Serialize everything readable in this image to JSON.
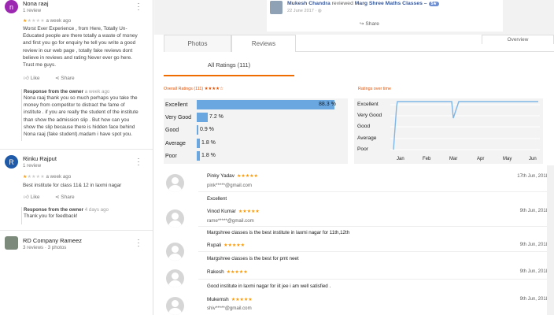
{
  "reviews": [
    {
      "initial": "n",
      "avatar_color": "#9c27b0",
      "name": "Nona raaj",
      "sub": "1 review",
      "rating": 1,
      "time": "a week ago",
      "text": "Worst Ever Experience , from Here, Totally Un-Educated people are there totally a waste of money and first you go for enquiry he tell you write a good review in our web page , totally fake reviews dont believe in reviews and rating Never ever go here. Trust me guys.",
      "like": "Like",
      "share": "Share",
      "owner_title": "Response from the owner",
      "owner_time": "a week ago",
      "owner_text": "Nona raaj thank you so much perhaps you take the money from competitor to distract the fame of institute . if you are really the student of the institute than show the admission slip . But how  can you show the slip because there is hidden face behind Nona raaj (fake student).madam i have spot you."
    },
    {
      "initial": "R",
      "avatar_color": "#1e5aa8",
      "name": "Rinku Rajput",
      "sub": "1 review",
      "rating": 1,
      "time": "a week ago",
      "text": "Best institute for class 11& 12 in laxmi nagar",
      "like": "Like",
      "share": "Share",
      "owner_title": "Response from the owner",
      "owner_time": "4 days ago",
      "owner_text": "Thank you for feedback!"
    },
    {
      "name": "RD Company Rameez",
      "sub": "3 reviews · 3 photos"
    }
  ],
  "facebook": {
    "name": "Mukesh Chandra",
    "reviewed": "reviewed",
    "page": "Marg Shree Maths Classes –",
    "badge": "5★",
    "date": "22 June 2017 · ",
    "share": "Share"
  },
  "tabs": {
    "photos": "Photos",
    "reviews": "Reviews",
    "overview": "Overview"
  },
  "all_ratings": "All Ratings (111)",
  "overall_title": "Overall Ratings (111) ★★★★☆",
  "over_time_title": "Ratings over time",
  "rating_bars": [
    {
      "label": "Excellent",
      "value": "88.3 %",
      "pct": 88.3
    },
    {
      "label": "Very Good",
      "value": "7.2 %",
      "pct": 7.2
    },
    {
      "label": "Good",
      "value": "0.9 %",
      "pct": 0.9
    },
    {
      "label": "Average",
      "value": "1.8 %",
      "pct": 1.8
    },
    {
      "label": "Poor",
      "value": "1.8 %",
      "pct": 1.8
    }
  ],
  "over_time": {
    "labels": [
      "Excellent",
      "Very Good",
      "Good",
      "Average",
      "Poor"
    ],
    "months": [
      "Jan",
      "Feb",
      "Mar",
      "Apr",
      "May",
      "Jun"
    ]
  },
  "users": [
    {
      "name": "Pinky Yadav",
      "stars": "★★★★★",
      "email": "pink*****@gmail.com",
      "date": "17th Jun, 2018",
      "text": "Excellent"
    },
    {
      "name": "Vinod Kumar",
      "stars": "★★★★★",
      "email": "rame*****@gmail.com",
      "date": "9th Jun, 2018",
      "text": "Margshree classes is the best institute in laxmi nagar for 11th,12th"
    },
    {
      "name": "Rupali",
      "stars": "★★★★★",
      "email": "",
      "date": "9th Jun, 2018",
      "text": "Margshree classes is the best for pmt neet"
    },
    {
      "name": "Rakesh",
      "stars": "★★★★★",
      "email": "",
      "date": "9th Jun, 2018",
      "text": "Good institute in laxmi nagar for iit jee i am well satisfied ."
    },
    {
      "name": "Mukemsh",
      "stars": "★★★★★",
      "email": "shiv*****@gmail.com",
      "date": "9th Jun, 2018",
      "text": ""
    }
  ]
}
